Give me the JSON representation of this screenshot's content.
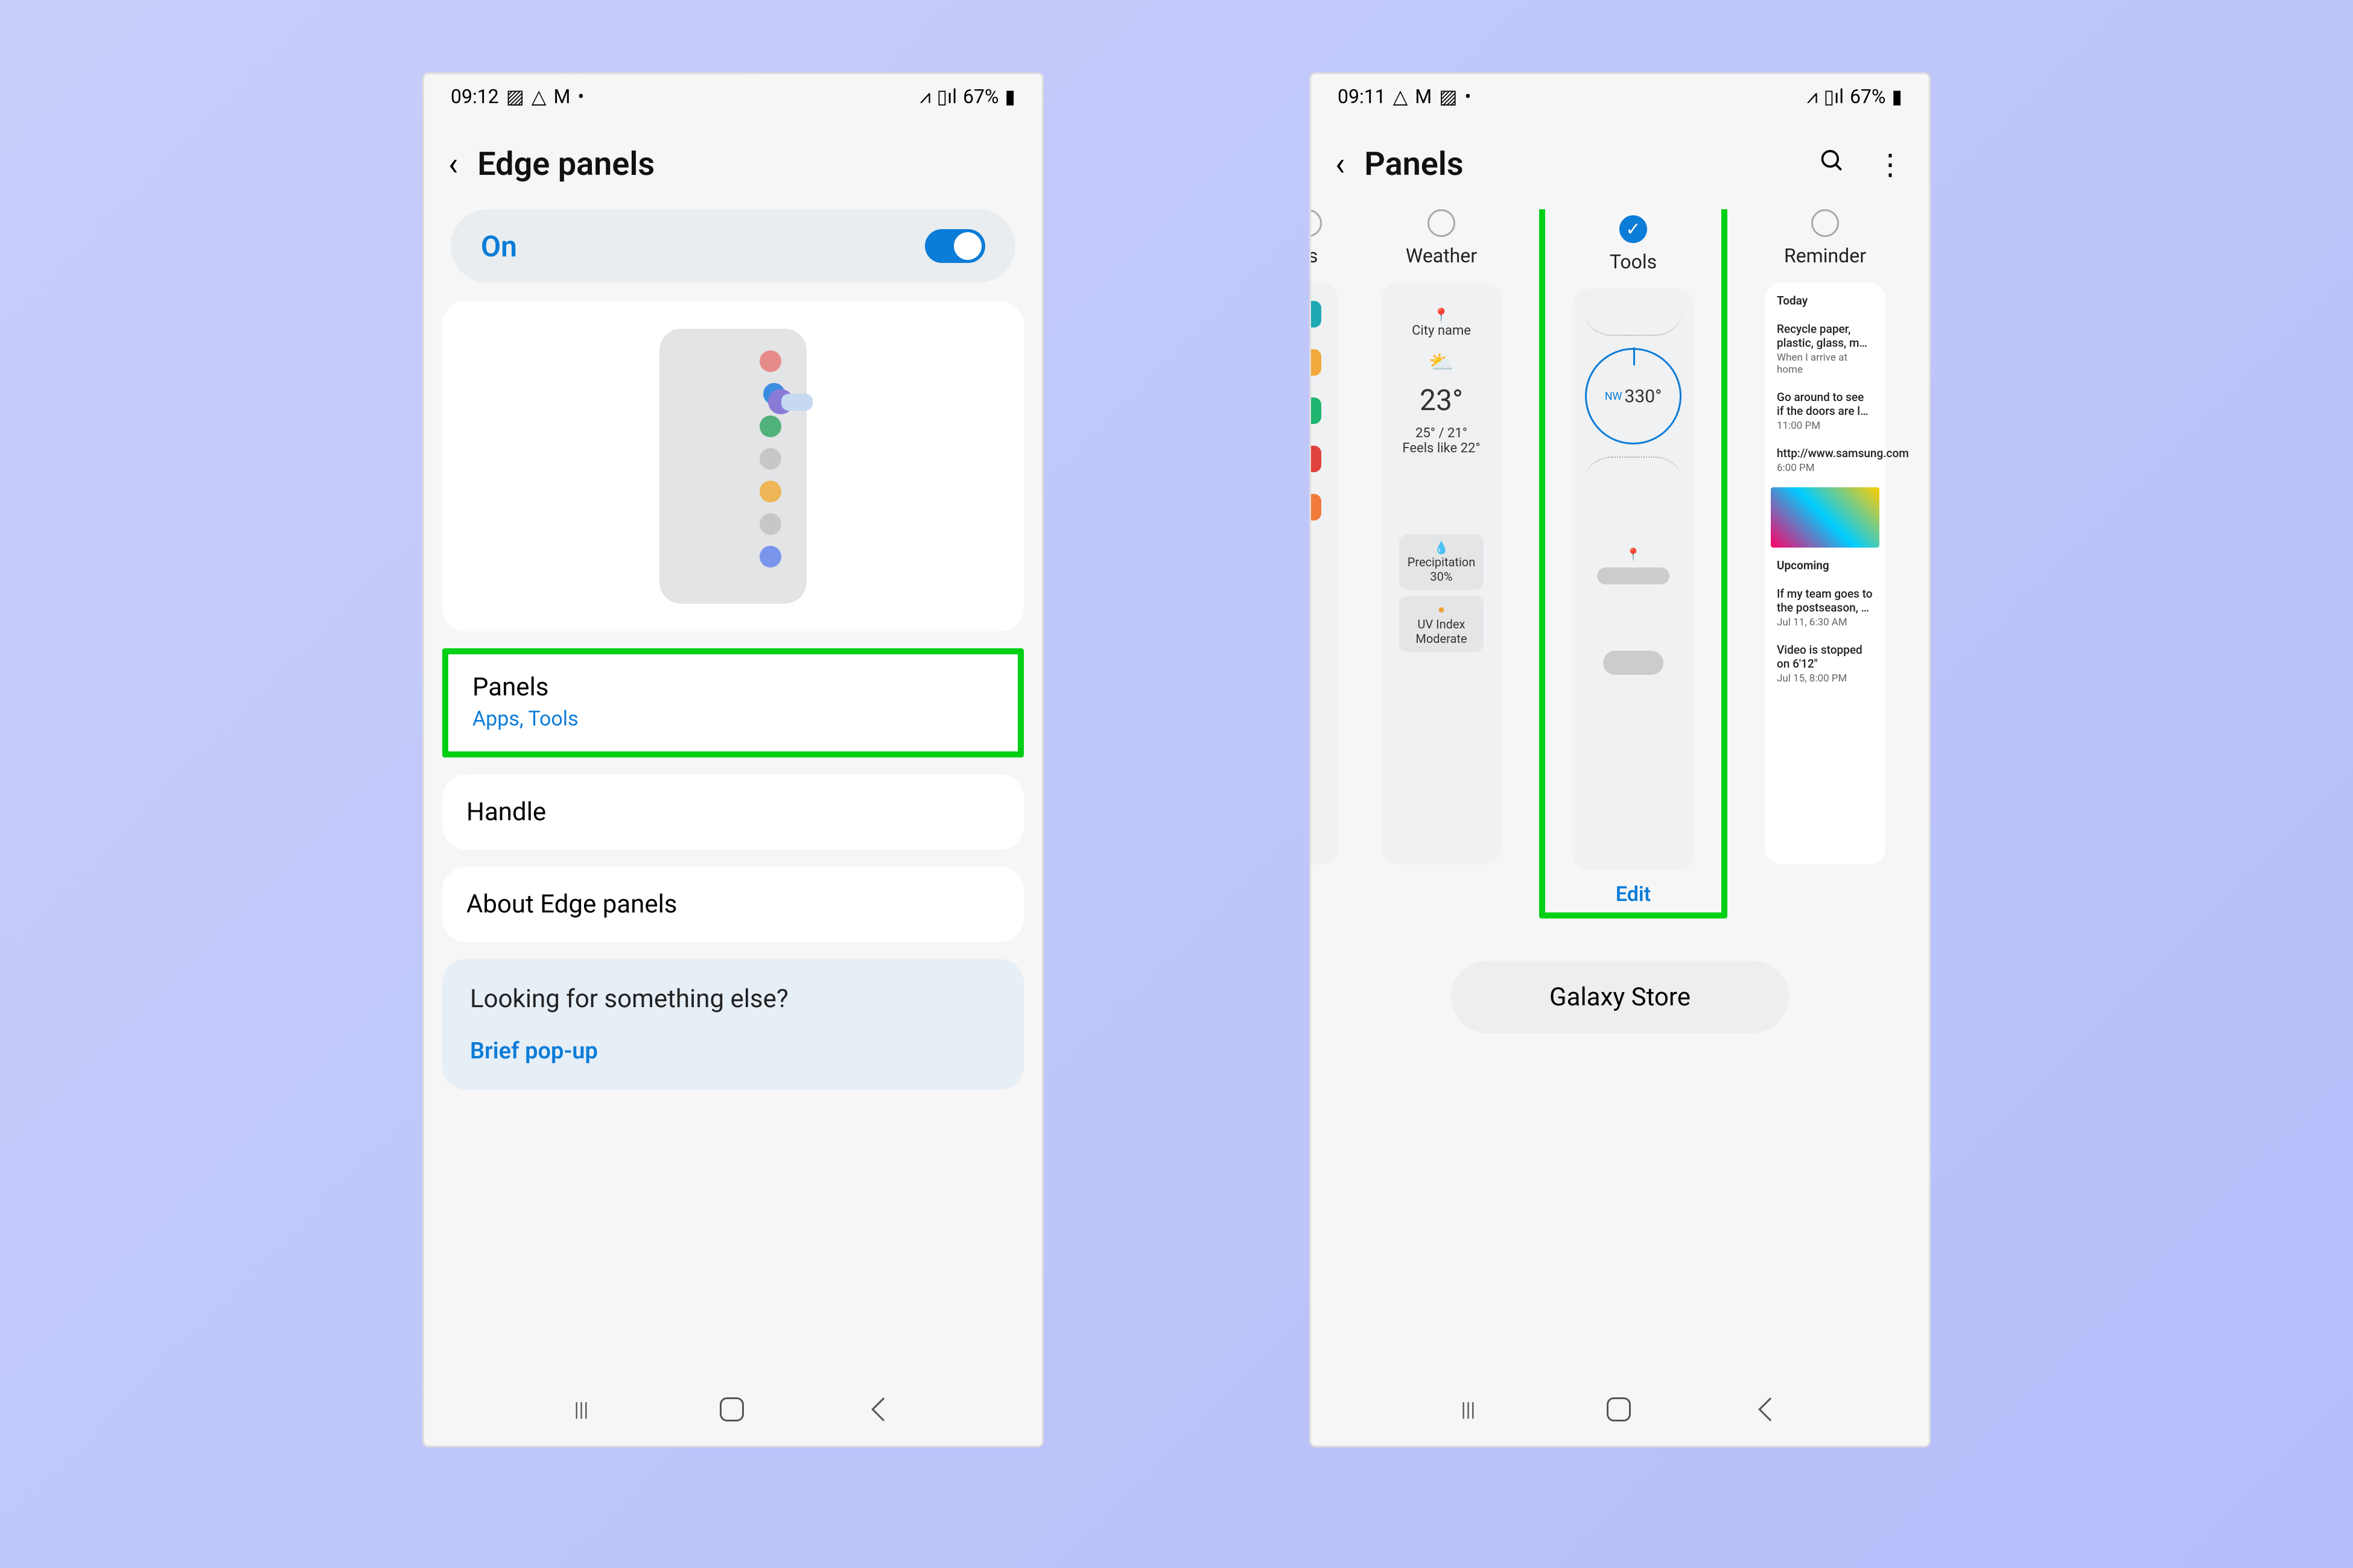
{
  "statusbar": {
    "time1": "09:12",
    "time2": "09:11",
    "battery": "67%"
  },
  "screen1": {
    "title": "Edge panels",
    "on_label": "On",
    "items": {
      "panels": {
        "label": "Panels",
        "sub": "Apps, Tools"
      },
      "handle": "Handle",
      "about": "About Edge panels"
    },
    "lookfor": {
      "q": "Looking for something else?",
      "link": "Brief pop-up"
    }
  },
  "screen2": {
    "title": "Panels",
    "tabs": {
      "tasks": "ks",
      "weather": "Weather",
      "tools": "Tools",
      "reminder": "Reminder"
    },
    "weather": {
      "city": "City name",
      "temp": "23°",
      "range": "25° / 21°",
      "feels": "Feels like 22°",
      "precip_label": "Precipitation",
      "precip_val": "30%",
      "uv_label": "UV Index",
      "uv_val": "Moderate"
    },
    "compass": {
      "dir": "NW",
      "deg": "330°"
    },
    "reminders": {
      "today_header": "Today",
      "r1": {
        "t": "Recycle paper, plastic, glass, m…",
        "s": "When I arrive at home"
      },
      "r2": {
        "t": "Go around to see if the doors are l…",
        "s": "11:00 PM"
      },
      "r3": {
        "t": "http://www.samsung.com",
        "s": "6:00 PM"
      },
      "upcoming_header": "Upcoming",
      "r4": {
        "t": "If my team goes to the postseason, …",
        "s": "Jul 11, 6:30 AM"
      },
      "r5": {
        "t": "Video is stopped on 6'12\"",
        "s": "Jul 15, 8:00 PM"
      }
    },
    "edit": "Edit",
    "store": "Galaxy Store"
  }
}
